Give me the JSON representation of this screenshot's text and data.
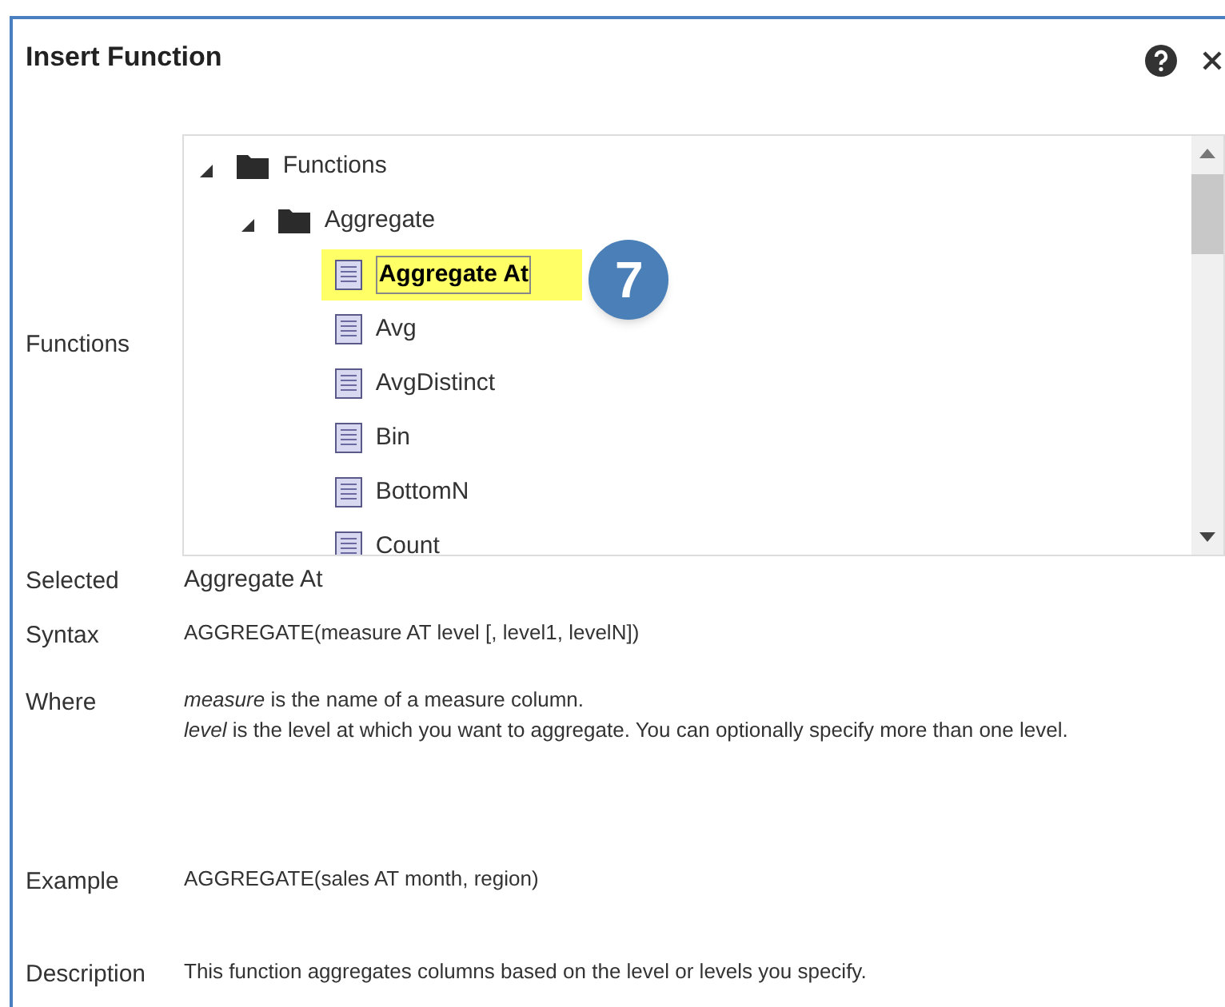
{
  "dialog": {
    "title": "Insert Function"
  },
  "functions": {
    "label": "Functions",
    "tree": [
      {
        "kind": "folder",
        "label": "Functions",
        "expanded": true,
        "selected": false,
        "children": [
          {
            "kind": "folder",
            "label": "Aggregate",
            "expanded": true,
            "selected": false,
            "children": [
              {
                "kind": "function",
                "label": "Aggregate At",
                "selected": true,
                "callout": "7"
              },
              {
                "kind": "function",
                "label": "Avg",
                "selected": false
              },
              {
                "kind": "function",
                "label": "AvgDistinct",
                "selected": false
              },
              {
                "kind": "function",
                "label": "Bin",
                "selected": false
              },
              {
                "kind": "function",
                "label": "BottomN",
                "selected": false
              },
              {
                "kind": "function",
                "label": "Count",
                "selected": false
              }
            ]
          }
        ]
      }
    ]
  },
  "details": [
    {
      "kind": "selected",
      "label": "Selected",
      "lines": [
        "Aggregate At"
      ]
    },
    {
      "kind": "syntax",
      "label": "Syntax",
      "lines": [
        "AGGREGATE(measure AT level [, level1, levelN])"
      ]
    },
    {
      "kind": "where",
      "label": "Where",
      "lines": [
        "*measure* is the name of a measure column.",
        "*level* is the level at which you want to aggregate. You can optionally specify more than one level."
      ]
    },
    {
      "kind": "example",
      "label": "Example",
      "lines": [
        "AGGREGATE(sales AT month, region)"
      ]
    },
    {
      "kind": "description",
      "label": "Description",
      "lines": [
        "This function aggregates columns based on the level or levels you specify."
      ]
    }
  ]
}
